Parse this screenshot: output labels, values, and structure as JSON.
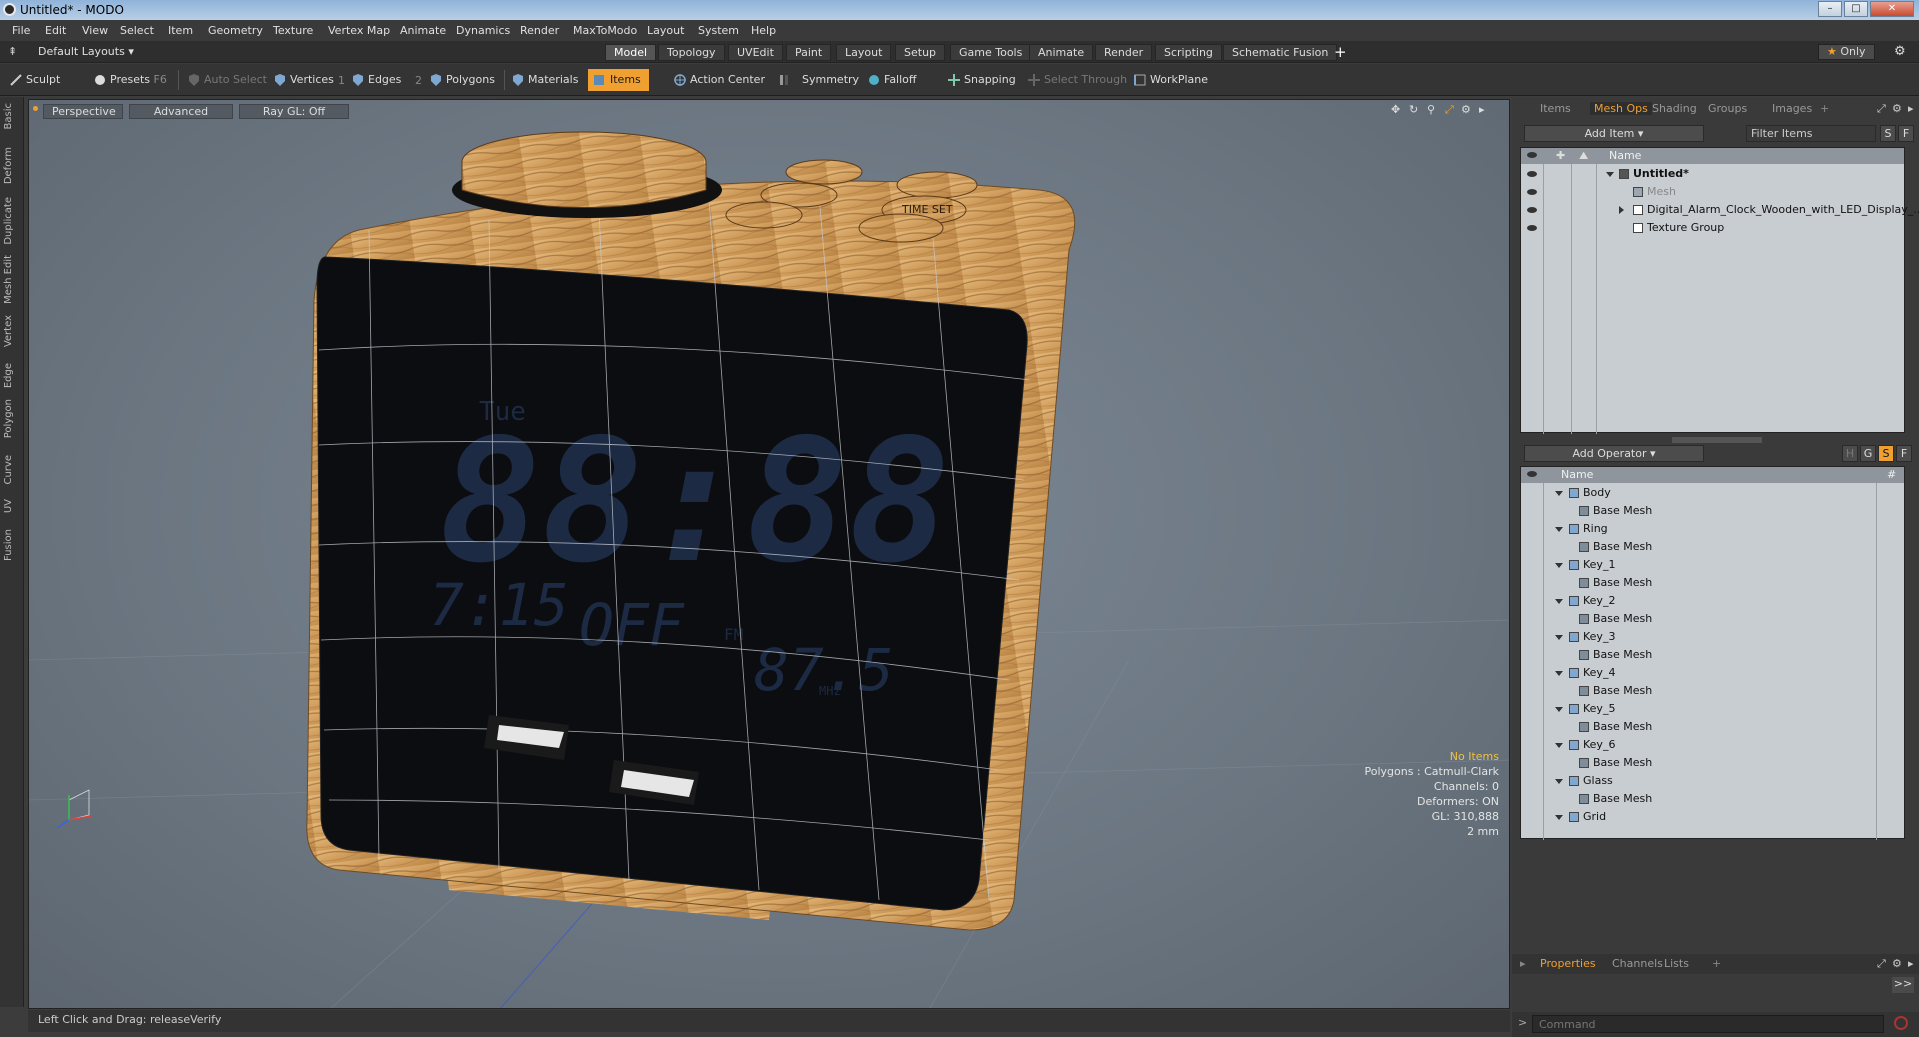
{
  "window": {
    "title": "Untitled* - MODO"
  },
  "menu": [
    "File",
    "Edit",
    "View",
    "Select",
    "Item",
    "Geometry",
    "Texture",
    "Vertex Map",
    "Animate",
    "Dynamics",
    "Render",
    "MaxToModo",
    "Layout",
    "System",
    "Help"
  ],
  "layouts_label": "Default Layouts",
  "layout_tabs": [
    "Model",
    "Topology",
    "UVEdit",
    "Paint",
    "Layout",
    "Setup",
    "Game Tools",
    "Animate",
    "Render",
    "Scripting",
    "Schematic Fusion"
  ],
  "only_label": "Only",
  "tools": {
    "sculpt": "Sculpt",
    "presets": "Presets",
    "presets_key": "F6",
    "auto_select": "Auto Select",
    "vertices": "Vertices",
    "vertices_count": "1",
    "edges": "Edges",
    "edges_count": "2",
    "polygons": "Polygons",
    "materials": "Materials",
    "items": "Items",
    "action_center": "Action Center",
    "symmetry": "Symmetry",
    "falloff": "Falloff",
    "snapping": "Snapping",
    "select_through": "Select Through",
    "workplane": "WorkPlane"
  },
  "left_tabs": [
    "Basic",
    "Deform",
    "Duplicate",
    "Mesh Edit",
    "Vertex",
    "Edge",
    "Polygon",
    "Curve",
    "UV",
    "Fusion"
  ],
  "viewport": {
    "view": "Perspective",
    "shading": "Advanced",
    "raygl": "Ray GL: Off",
    "stats": {
      "no_items": "No Items",
      "polygons": "Polygons : Catmull-Clark",
      "channels": "Channels: 0",
      "deformers": "Deformers: ON",
      "gl": "GL: 310,888",
      "scale": "2 mm"
    },
    "display": {
      "day": "Tue",
      "time": "88:88",
      "alarm": "7:15",
      "off": "OFF",
      "fm": "FM",
      "freq": "87.5",
      "mhz": "MHz",
      "time_set": "TIME SET"
    }
  },
  "right_tabs": [
    "Items",
    "Mesh Ops",
    "Shading",
    "Groups",
    "Images"
  ],
  "items_panel": {
    "add_item": "Add Item",
    "filter": "Filter Items",
    "s": "S",
    "f": "F",
    "header": "Name",
    "rows": [
      {
        "label": "Untitled*"
      },
      {
        "label": "Mesh"
      },
      {
        "label": "Digital_Alarm_Clock_Wooden_with_LED_Display_..."
      },
      {
        "label": "Texture Group"
      }
    ]
  },
  "meshops_panel": {
    "add_operator": "Add Operator",
    "h": "H",
    "g": "G",
    "s": "S",
    "f": "F",
    "header": "Name",
    "hash": "#",
    "rows": [
      "Body",
      "Base Mesh",
      "Ring",
      "Base Mesh",
      "Key_1",
      "Base Mesh",
      "Key_2",
      "Base Mesh",
      "Key_3",
      "Base Mesh",
      "Key_4",
      "Base Mesh",
      "Key_5",
      "Base Mesh",
      "Key_6",
      "Base Mesh",
      "Glass",
      "Base Mesh",
      "Grid"
    ]
  },
  "bottom_tabs": [
    "Properties",
    "Channels",
    "Lists"
  ],
  "status": {
    "text": "Left Click and Drag:   releaseVerify"
  },
  "command": {
    "placeholder": "Command"
  },
  "colors": {
    "accent": "#f0a030",
    "viewport_bg": "#6f7a85",
    "wood": "#d6a868"
  }
}
